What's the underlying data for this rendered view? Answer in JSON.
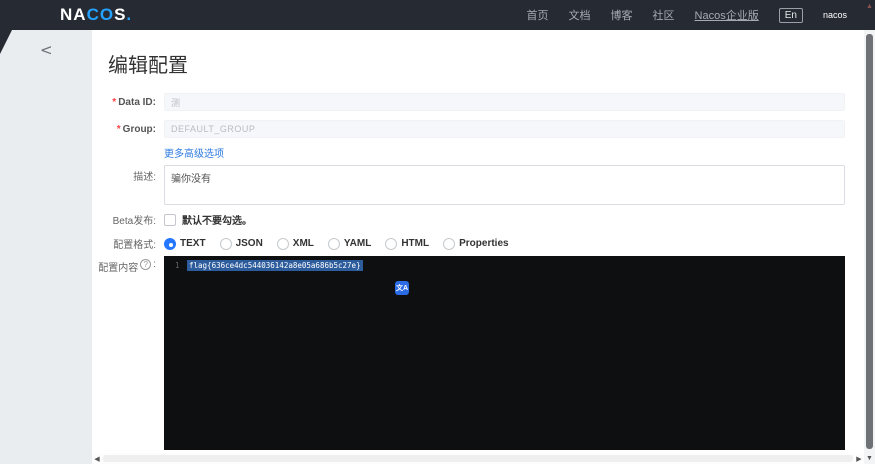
{
  "header": {
    "logo": {
      "na": "NA",
      "co": "CO",
      "s": "S",
      "dot": "."
    },
    "nav": [
      "首页",
      "文档",
      "博客",
      "社区",
      "Nacos企业版"
    ],
    "lang_button": "En",
    "username": "nacos"
  },
  "sidebar": {
    "collapse_icon": "<"
  },
  "page": {
    "title": "编辑配置"
  },
  "form": {
    "required_mark": "*",
    "data_id": {
      "label": "Data ID:",
      "value": "测"
    },
    "group": {
      "label": "Group:",
      "value": "DEFAULT_GROUP"
    },
    "advanced_link": "更多高级选项",
    "description": {
      "label": "描述:",
      "value": "骗你没有"
    },
    "beta": {
      "label": "Beta发布:",
      "hint": "默认不要勾选。",
      "checked": false
    },
    "format": {
      "label": "配置格式:",
      "options": [
        "TEXT",
        "JSON",
        "XML",
        "YAML",
        "HTML",
        "Properties"
      ],
      "selected": "TEXT"
    },
    "content": {
      "label": "配置内容",
      "colon": ":",
      "line_number": "1",
      "code": "flag{636ce4dc544036142a8e05a686b5c27e}"
    }
  },
  "icons": {
    "help": "?",
    "translate": "文A",
    "up_arrow": "▲",
    "down_arrow": "▼",
    "left_arrow": "◀",
    "right_arrow": "▶"
  },
  "colors": {
    "header_bg": "#262b33",
    "logo_blue": "#24a2ff",
    "accent_blue": "#2577ff",
    "link_blue": "#2d7ae0",
    "required_red": "#ff4143",
    "editor_bg": "#0e0f10",
    "selection_blue": "#2d5c9c",
    "translate_icon_blue": "#2b6be4",
    "sidebar_bg": "#e9edf0"
  }
}
